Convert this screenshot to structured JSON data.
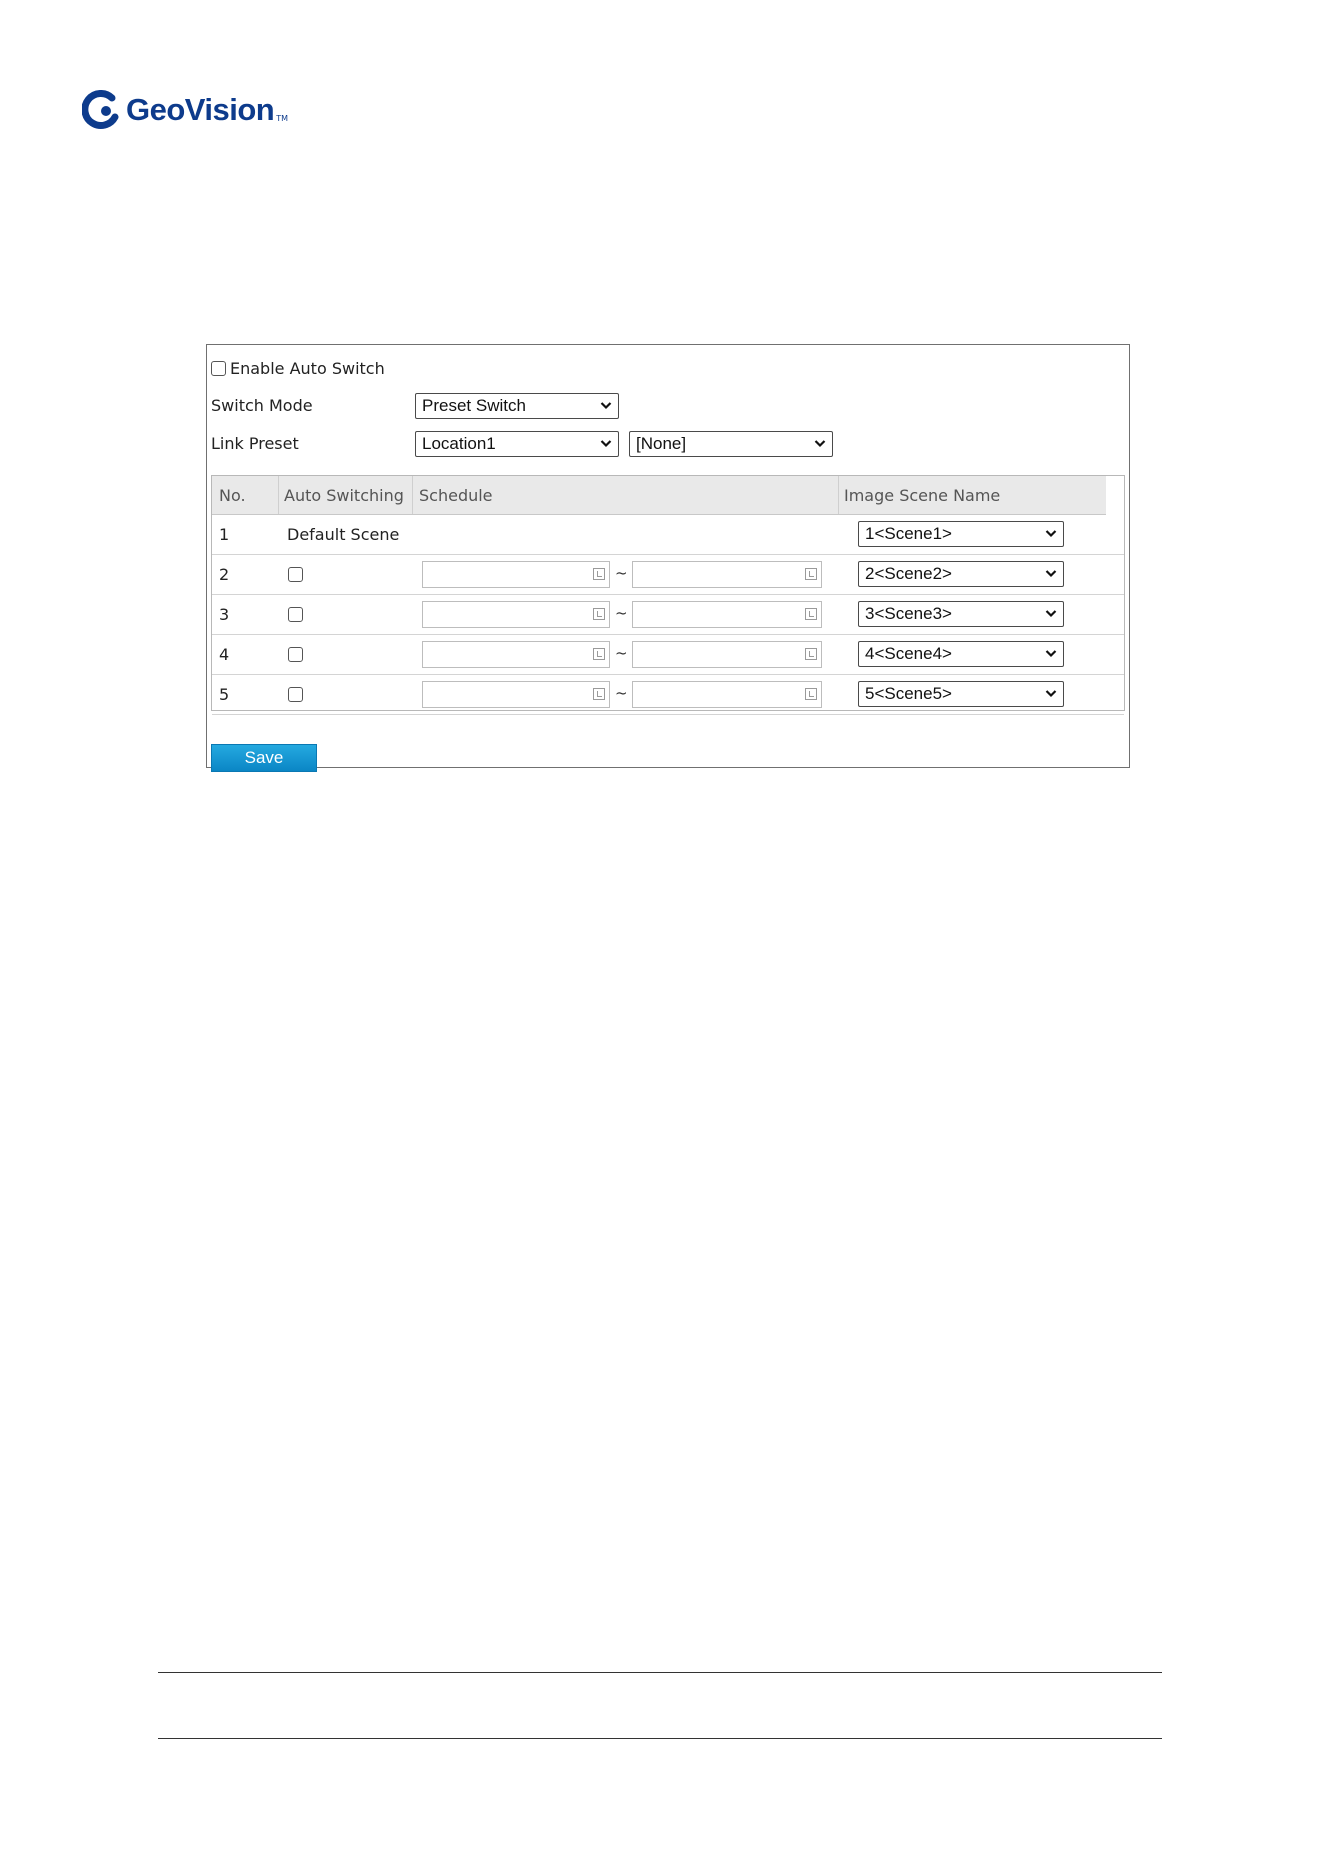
{
  "brand": {
    "logo_text": "GeoVision",
    "logo_mark": "TM"
  },
  "form": {
    "enable_auto_switch_label": "Enable Auto Switch",
    "switch_mode_label": "Switch Mode",
    "switch_mode_value": "Preset Switch",
    "link_preset_label": "Link Preset",
    "link_preset_value": "Location1",
    "link_preset_extra_value": "[None]"
  },
  "table": {
    "headers": [
      "No.",
      "Auto Switching",
      "Schedule",
      "Image Scene Name"
    ],
    "rows": [
      {
        "no": "1",
        "auto": "Default Scene",
        "scene": "1<Scene1>"
      },
      {
        "no": "2",
        "scene": "2<Scene2>"
      },
      {
        "no": "3",
        "scene": "3<Scene3>"
      },
      {
        "no": "4",
        "scene": "4<Scene4>"
      },
      {
        "no": "5",
        "scene": "5<Scene5>"
      }
    ],
    "range_separator": "~"
  },
  "actions": {
    "save_label": "Save"
  },
  "colors": {
    "brand_blue": "#0d3b8c",
    "button_blue": "#1a9ad6",
    "header_gray": "#e9e9e9"
  },
  "icons": [
    "geovision-logo-icon",
    "chevron-down-icon",
    "calendar-icon",
    "checkbox-icon"
  ]
}
